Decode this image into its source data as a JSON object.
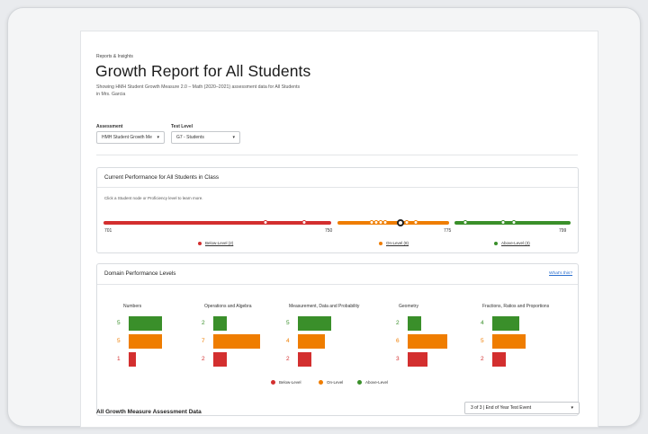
{
  "header": {
    "breadcrumb": "Reports & Insights",
    "title": "Growth Report for All Students",
    "subtitle": "Showing HMH Student Growth Measure 2.0 – Math (2020–2021) assessment data for All Students in Mrs. Garcia"
  },
  "filters": {
    "assessment_label": "Assessment",
    "assessment_value": "HMH Student Growth Me",
    "test_level_label": "Test Level",
    "test_level_value": "G7 - Students"
  },
  "performance": {
    "title": "Current Performance for All Students in Class",
    "hint": "Click a Student node or Proficiency level to learn more.",
    "scale": [
      "701",
      "750",
      "775",
      "799"
    ],
    "legend": [
      {
        "label": "Below-Level (2)",
        "color": "#d32f2f"
      },
      {
        "label": "On-Level (8)",
        "color": "#ef7d00"
      },
      {
        "label": "Above-Level (3)",
        "color": "#3a8f2a"
      }
    ]
  },
  "domains": {
    "title": "Domain Performance Levels",
    "whats_this": "What's this?",
    "items": [
      {
        "name": "Numbers",
        "above": "5",
        "on": "5",
        "below": "1"
      },
      {
        "name": "Operations and Algebra",
        "above": "2",
        "on": "7",
        "below": "2"
      },
      {
        "name": "Measurement, Data and Probability",
        "above": "5",
        "on": "4",
        "below": "2"
      },
      {
        "name": "Geometry",
        "above": "2",
        "on": "6",
        "below": "3"
      },
      {
        "name": "Fractions, Ratios and Proportions",
        "above": "4",
        "on": "5",
        "below": "2"
      }
    ],
    "legend": {
      "below": "Below-Level",
      "on": "On-Level",
      "above": "Above-Level"
    }
  },
  "assessment_data": {
    "title": "All Growth Measure Assessment Data",
    "event": "3 of 3 | End of Year Test Event"
  },
  "colors": {
    "below": "#d32f2f",
    "on": "#ef7d00",
    "above": "#3a8f2a",
    "link": "#2b6fce"
  }
}
